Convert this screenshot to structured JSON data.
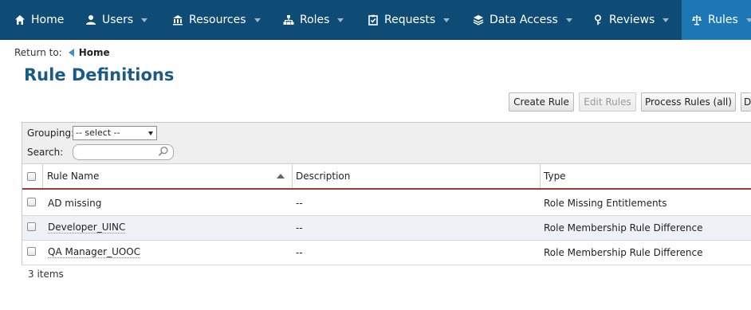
{
  "nav": {
    "items": [
      {
        "label": "Home",
        "icon": "home-icon"
      },
      {
        "label": "Users",
        "icon": "users-icon"
      },
      {
        "label": "Resources",
        "icon": "resources-icon"
      },
      {
        "label": "Roles",
        "icon": "roles-icon"
      },
      {
        "label": "Requests",
        "icon": "requests-icon"
      },
      {
        "label": "Data Access",
        "icon": "data-access-icon"
      },
      {
        "label": "Reviews",
        "icon": "reviews-icon"
      },
      {
        "label": "Rules",
        "icon": "rules-icon",
        "active": true
      }
    ],
    "colors": {
      "background": "#0f4c75",
      "active": "#1e77b5"
    }
  },
  "breadcrumb": {
    "prefix": "Return to:",
    "home": "Home"
  },
  "page": {
    "title": "Rule Definitions"
  },
  "actions": {
    "create": "Create Rule",
    "edit": "Edit Rules",
    "process": "Process Rules (all)",
    "more": "D"
  },
  "toolbar": {
    "grouping_label": "Grouping:",
    "grouping_value": "-- select --",
    "search_label": "Search:",
    "search_value": ""
  },
  "table": {
    "columns": [
      "Rule Name",
      "Description",
      "Type"
    ],
    "rows": [
      {
        "name": "AD missing",
        "description": "--",
        "type": "Role Missing Entitlements"
      },
      {
        "name": "Developer_UINC",
        "description": "--",
        "type": "Role Membership Rule Difference"
      },
      {
        "name": "QA Manager_UOOC",
        "description": "--",
        "type": "Role Membership Rule Difference"
      }
    ],
    "count": "3 items"
  }
}
